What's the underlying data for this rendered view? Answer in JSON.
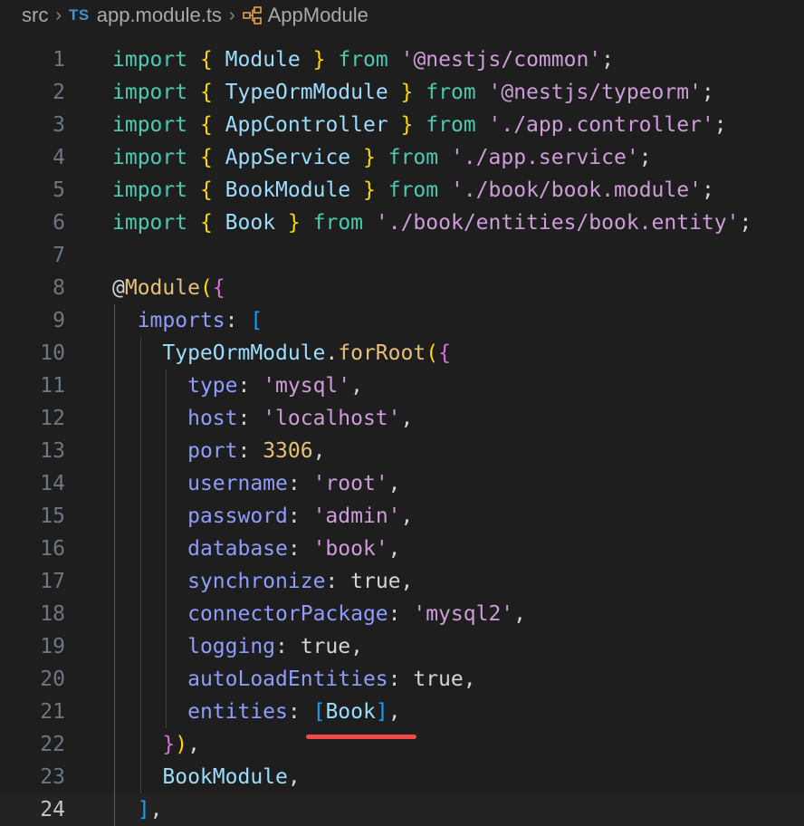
{
  "breadcrumb": {
    "folder": "src",
    "file_badge": "TS",
    "file": "app.module.ts",
    "symbol": "AppModule"
  },
  "editor": {
    "current_line": 24,
    "lines": [
      {
        "n": "1",
        "tokens": [
          [
            "kw",
            "import"
          ],
          [
            "plain",
            " "
          ],
          [
            "br1",
            "{"
          ],
          [
            "plain",
            " "
          ],
          [
            "cls",
            "Module"
          ],
          [
            "plain",
            " "
          ],
          [
            "br1",
            "}"
          ],
          [
            "plain",
            " "
          ],
          [
            "from",
            "from"
          ],
          [
            "plain",
            " "
          ],
          [
            "str",
            "'@nestjs/common'"
          ],
          [
            "plain",
            ";"
          ]
        ]
      },
      {
        "n": "2",
        "tokens": [
          [
            "kw",
            "import"
          ],
          [
            "plain",
            " "
          ],
          [
            "br1",
            "{"
          ],
          [
            "plain",
            " "
          ],
          [
            "cls",
            "TypeOrmModule"
          ],
          [
            "plain",
            " "
          ],
          [
            "br1",
            "}"
          ],
          [
            "plain",
            " "
          ],
          [
            "from",
            "from"
          ],
          [
            "plain",
            " "
          ],
          [
            "str",
            "'@nestjs/typeorm'"
          ],
          [
            "plain",
            ";"
          ]
        ]
      },
      {
        "n": "3",
        "tokens": [
          [
            "kw",
            "import"
          ],
          [
            "plain",
            " "
          ],
          [
            "br1",
            "{"
          ],
          [
            "plain",
            " "
          ],
          [
            "cls",
            "AppController"
          ],
          [
            "plain",
            " "
          ],
          [
            "br1",
            "}"
          ],
          [
            "plain",
            " "
          ],
          [
            "from",
            "from"
          ],
          [
            "plain",
            " "
          ],
          [
            "str",
            "'./app.controller'"
          ],
          [
            "plain",
            ";"
          ]
        ]
      },
      {
        "n": "4",
        "tokens": [
          [
            "kw",
            "import"
          ],
          [
            "plain",
            " "
          ],
          [
            "br1",
            "{"
          ],
          [
            "plain",
            " "
          ],
          [
            "cls",
            "AppService"
          ],
          [
            "plain",
            " "
          ],
          [
            "br1",
            "}"
          ],
          [
            "plain",
            " "
          ],
          [
            "from",
            "from"
          ],
          [
            "plain",
            " "
          ],
          [
            "str",
            "'./app.service'"
          ],
          [
            "plain",
            ";"
          ]
        ]
      },
      {
        "n": "5",
        "tokens": [
          [
            "kw",
            "import"
          ],
          [
            "plain",
            " "
          ],
          [
            "br1",
            "{"
          ],
          [
            "plain",
            " "
          ],
          [
            "cls",
            "BookModule"
          ],
          [
            "plain",
            " "
          ],
          [
            "br1",
            "}"
          ],
          [
            "plain",
            " "
          ],
          [
            "from",
            "from"
          ],
          [
            "plain",
            " "
          ],
          [
            "str",
            "'./book/book.module'"
          ],
          [
            "plain",
            ";"
          ]
        ]
      },
      {
        "n": "6",
        "tokens": [
          [
            "kw",
            "import"
          ],
          [
            "plain",
            " "
          ],
          [
            "br1",
            "{"
          ],
          [
            "plain",
            " "
          ],
          [
            "cls",
            "Book"
          ],
          [
            "plain",
            " "
          ],
          [
            "br1",
            "}"
          ],
          [
            "plain",
            " "
          ],
          [
            "from",
            "from"
          ],
          [
            "plain",
            " "
          ],
          [
            "str",
            "'./book/entities/book.entity'"
          ],
          [
            "plain",
            ";"
          ]
        ]
      },
      {
        "n": "7",
        "tokens": []
      },
      {
        "n": "8",
        "tokens": [
          [
            "plain",
            "@"
          ],
          [
            "num",
            "Module"
          ],
          [
            "br1",
            "("
          ],
          [
            "br2",
            "{"
          ]
        ]
      },
      {
        "n": "9",
        "tokens": [
          [
            "plain",
            "  "
          ],
          [
            "prop",
            "imports"
          ],
          [
            "plain",
            ": "
          ],
          [
            "br3",
            "["
          ]
        ]
      },
      {
        "n": "10",
        "tokens": [
          [
            "plain",
            "    "
          ],
          [
            "cls",
            "TypeOrmModule"
          ],
          [
            "plain",
            "."
          ],
          [
            "num",
            "forRoot"
          ],
          [
            "br1",
            "("
          ],
          [
            "br2",
            "{"
          ]
        ]
      },
      {
        "n": "11",
        "tokens": [
          [
            "plain",
            "      "
          ],
          [
            "prop",
            "type"
          ],
          [
            "plain",
            ": "
          ],
          [
            "str",
            "'mysql'"
          ],
          [
            "plain",
            ","
          ]
        ]
      },
      {
        "n": "12",
        "tokens": [
          [
            "plain",
            "      "
          ],
          [
            "prop",
            "host"
          ],
          [
            "plain",
            ": "
          ],
          [
            "str",
            "'localhost'"
          ],
          [
            "plain",
            ","
          ]
        ]
      },
      {
        "n": "13",
        "tokens": [
          [
            "plain",
            "      "
          ],
          [
            "prop",
            "port"
          ],
          [
            "plain",
            ": "
          ],
          [
            "num",
            "3306"
          ],
          [
            "plain",
            ","
          ]
        ]
      },
      {
        "n": "14",
        "tokens": [
          [
            "plain",
            "      "
          ],
          [
            "prop",
            "username"
          ],
          [
            "plain",
            ": "
          ],
          [
            "str",
            "'root'"
          ],
          [
            "plain",
            ","
          ]
        ]
      },
      {
        "n": "15",
        "tokens": [
          [
            "plain",
            "      "
          ],
          [
            "prop",
            "password"
          ],
          [
            "plain",
            ": "
          ],
          [
            "str",
            "'admin'"
          ],
          [
            "plain",
            ","
          ]
        ]
      },
      {
        "n": "16",
        "tokens": [
          [
            "plain",
            "      "
          ],
          [
            "prop",
            "database"
          ],
          [
            "plain",
            ": "
          ],
          [
            "str",
            "'book'"
          ],
          [
            "plain",
            ","
          ]
        ]
      },
      {
        "n": "17",
        "tokens": [
          [
            "plain",
            "      "
          ],
          [
            "prop",
            "synchronize"
          ],
          [
            "plain",
            ": "
          ],
          [
            "plain",
            "true"
          ],
          [
            "plain",
            ","
          ]
        ]
      },
      {
        "n": "18",
        "tokens": [
          [
            "plain",
            "      "
          ],
          [
            "prop",
            "connectorPackage"
          ],
          [
            "plain",
            ": "
          ],
          [
            "str",
            "'mysql2'"
          ],
          [
            "plain",
            ","
          ]
        ]
      },
      {
        "n": "19",
        "tokens": [
          [
            "plain",
            "      "
          ],
          [
            "prop",
            "logging"
          ],
          [
            "plain",
            ": "
          ],
          [
            "plain",
            "true"
          ],
          [
            "plain",
            ","
          ]
        ]
      },
      {
        "n": "20",
        "tokens": [
          [
            "plain",
            "      "
          ],
          [
            "prop",
            "autoLoadEntities"
          ],
          [
            "plain",
            ": "
          ],
          [
            "plain",
            "true"
          ],
          [
            "plain",
            ","
          ]
        ]
      },
      {
        "n": "21",
        "tokens": [
          [
            "plain",
            "      "
          ],
          [
            "prop",
            "entities"
          ],
          [
            "plain",
            ": "
          ],
          [
            "br3",
            "["
          ],
          [
            "cls",
            "Book"
          ],
          [
            "br3",
            "]"
          ],
          [
            "plain",
            ","
          ]
        ]
      },
      {
        "n": "22",
        "tokens": [
          [
            "plain",
            "    "
          ],
          [
            "br2",
            "}"
          ],
          [
            "br1",
            ")"
          ],
          [
            "plain",
            ","
          ]
        ]
      },
      {
        "n": "23",
        "tokens": [
          [
            "plain",
            "    "
          ],
          [
            "cls",
            "BookModule"
          ],
          [
            "plain",
            ","
          ]
        ]
      },
      {
        "n": "24",
        "tokens": [
          [
            "plain",
            "  "
          ],
          [
            "br3",
            "]"
          ],
          [
            "plain",
            ","
          ]
        ]
      }
    ]
  },
  "colors": {
    "background": "#1e1e1e",
    "annotation_underline": "#f04a4a"
  }
}
